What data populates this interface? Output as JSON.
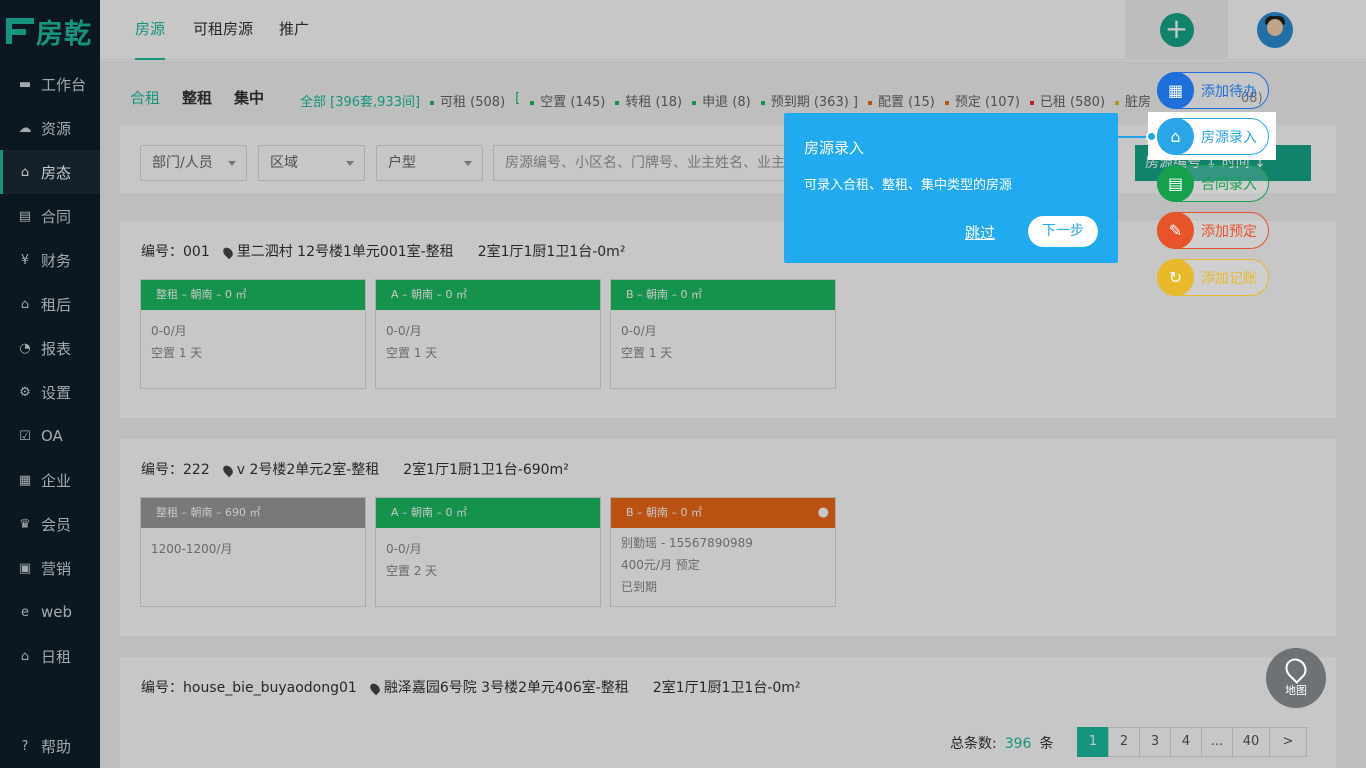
{
  "brand": {
    "logo_text": "房乾"
  },
  "sidebar": {
    "items": [
      {
        "label": "工作台",
        "icon": "monitor-icon"
      },
      {
        "label": "资源",
        "icon": "cloud-icon"
      },
      {
        "label": "房态",
        "icon": "home-icon"
      },
      {
        "label": "合同",
        "icon": "document-icon"
      },
      {
        "label": "财务",
        "icon": "yen-icon"
      },
      {
        "label": "租后",
        "icon": "home-icon"
      },
      {
        "label": "报表",
        "icon": "pie-chart-icon"
      },
      {
        "label": "设置",
        "icon": "gear-icon"
      },
      {
        "label": "OA",
        "icon": "check-box-icon"
      },
      {
        "label": "企业",
        "icon": "building-icon"
      },
      {
        "label": "会员",
        "icon": "crown-icon"
      },
      {
        "label": "营销",
        "icon": "gift-icon"
      },
      {
        "label": "web",
        "icon": "web-icon"
      },
      {
        "label": "日租",
        "icon": "home-icon"
      }
    ],
    "help": "帮助"
  },
  "topbar": {
    "tabs": [
      "房源",
      "可租房源",
      "推广"
    ],
    "add_symbol": "+"
  },
  "subtabs": [
    "合租",
    "整租",
    "集中"
  ],
  "status": {
    "all": "全部 [396套,933间]",
    "items": [
      {
        "label": "可租 (508)",
        "color": "#1bbd62"
      },
      {
        "label": "[ ",
        "color": ""
      },
      {
        "label": "空置 (145)",
        "color": "#1bbd62"
      },
      {
        "label": "转租 (18)",
        "color": "#1bbd62"
      },
      {
        "label": "申退 (8)",
        "color": "#1bbd62"
      },
      {
        "label": "预到期 (363) ]",
        "color": "#1bbd62"
      },
      {
        "label": "配置 (15)",
        "color": "#ef6a19"
      },
      {
        "label": "预定 (107)",
        "color": "#ef6a19"
      },
      {
        "label": "已租 (580)",
        "color": "#e32a2a"
      },
      {
        "label": "脏房",
        "color": "#e8b92a"
      }
    ],
    "trailing": "08)"
  },
  "filters": {
    "dept": "部门/人员",
    "area": "区域",
    "type": "户型",
    "search_placeholder": "房源编号、小区名、门牌号、业主姓名、业主",
    "sort_text": "房源编号 ↓    时间 ↓"
  },
  "houses": [
    {
      "code": "编号：001",
      "address": "里二泗村 12号楼1单元001室-整租",
      "layout": "2室1厅1厨1卫1台-0m²",
      "rooms": [
        {
          "bar": "整租 – 朝南 – 0 ㎡",
          "lines": [
            "0-0/月",
            "空置 1 天"
          ]
        },
        {
          "bar": "A – 朝南 – 0 ㎡",
          "lines": [
            "0-0/月",
            "空置 1 天"
          ]
        },
        {
          "bar": "B – 朝南 – 0 ㎡",
          "lines": [
            "0-0/月",
            "空置 1 天"
          ]
        }
      ]
    },
    {
      "code": "编号：222",
      "address": "v 2号楼2单元2室-整租",
      "layout": "2室1厅1厨1卫1台-690m²",
      "rooms": [
        {
          "bar": "整租 – 朝南 – 690 ㎡",
          "lines": [
            "1200-1200/月"
          ]
        },
        {
          "bar": "A – 朝南 – 0 ㎡",
          "lines": [
            "0-0/月",
            "空置 2 天"
          ]
        },
        {
          "bar": "B – 朝南 – 0 ㎡",
          "lines": [
            "别勤瑶 - 15567890989",
            "400元/月   预定",
            "已到期"
          ]
        }
      ]
    },
    {
      "code": "编号：house_bie_buyaodong01",
      "address": "融泽嘉园6号院 3号楼2单元406室-整租",
      "layout": "2室1厅1厨1卫1台-0m²"
    }
  ],
  "pager": {
    "total_label": "总条数:",
    "total": "396",
    "unit": "条",
    "pages": [
      "1",
      "2",
      "3",
      "4",
      "...",
      "40",
      ">"
    ]
  },
  "fabs": [
    {
      "label": "添加待办",
      "icon": "calendar-icon"
    },
    {
      "label": "房源录入",
      "icon": "house-add-icon"
    },
    {
      "label": "合同录入",
      "icon": "contract-icon"
    },
    {
      "label": "添加预定",
      "icon": "edit-icon"
    },
    {
      "label": "添加记账",
      "icon": "refresh-icon"
    }
  ],
  "tour": {
    "title": "房源录入",
    "desc": "可录入合租、整租、集中类型的房源",
    "skip": "跳过",
    "next": "下一步"
  },
  "map": {
    "label": "地图"
  }
}
